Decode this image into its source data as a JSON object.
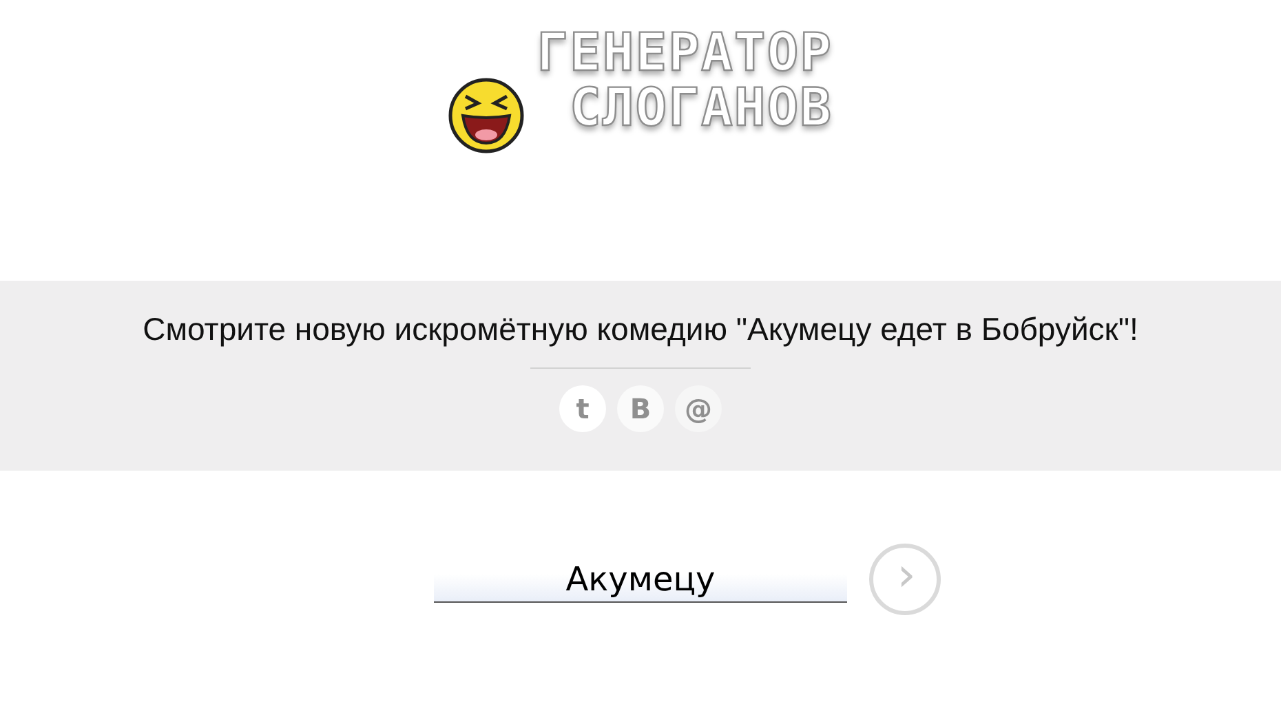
{
  "logo": {
    "lines": [
      "ГЕНЕРАТОР",
      "СЛОГАНОВ"
    ]
  },
  "slogan": "Смотрите новую искромётную комедию \"Акумецу едет в Бобруйск\"!",
  "share_buttons": [
    {
      "kind": "twitter",
      "glyph": "t"
    },
    {
      "kind": "vk",
      "glyph": "В"
    },
    {
      "kind": "email",
      "glyph": "@"
    }
  ],
  "input": {
    "value": "Акумецу"
  },
  "submit": {
    "glyph": "›"
  }
}
